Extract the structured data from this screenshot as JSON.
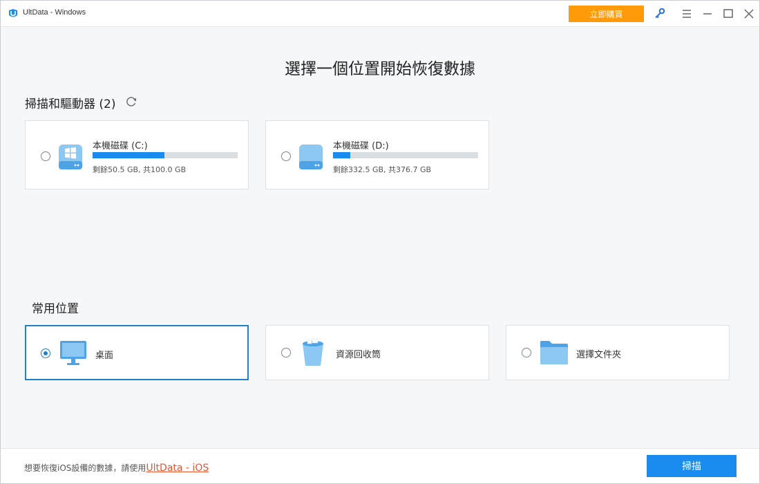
{
  "window": {
    "title": "UltData - Windows"
  },
  "titlebar": {
    "buy_label": "立即購買"
  },
  "main": {
    "title": "選擇一個位置開始恢復數據"
  },
  "drives": {
    "heading": "掃描和驅動器 (2)",
    "items": [
      {
        "name": "本機磁碟 (C:)",
        "free_text": "剩餘50.5 GB, 共100.0 GB",
        "used_fraction": 0.495,
        "selected": false
      },
      {
        "name": "本機磁碟 (D:)",
        "free_text": "剩餘332.5 GB, 共376.7 GB",
        "used_fraction": 0.117,
        "selected": false
      }
    ]
  },
  "common": {
    "heading": "常用位置",
    "items": [
      {
        "label": "桌面",
        "icon": "desktop-monitor-icon",
        "selected": true
      },
      {
        "label": "資源回收筒",
        "icon": "recycle-bin-icon",
        "selected": false
      },
      {
        "label": "選擇文件夾",
        "icon": "folder-icon",
        "selected": false
      }
    ]
  },
  "footer": {
    "prompt": "想要恢復iOS設備的數據，請使用",
    "link_label": "UltData - iOS",
    "scan_label": "掃描"
  },
  "colors": {
    "accent": "#1a8cf0",
    "buy": "#ff9a0a",
    "link": "#e8532b",
    "selected_border": "#1f7fc7"
  }
}
